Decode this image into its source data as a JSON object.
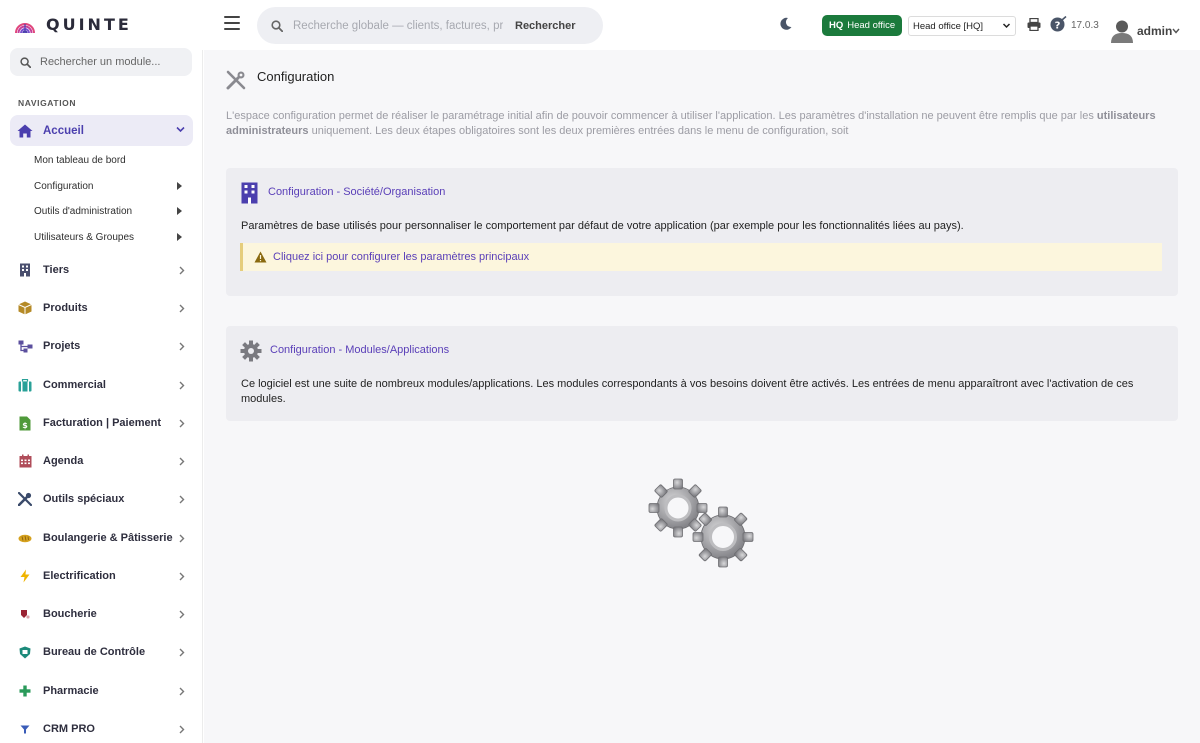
{
  "header": {
    "app_name": "QUINTE",
    "search_placeholder": "Recherche globale — clients, factures, prod",
    "search_button": "Rechercher",
    "entity_badge_code": "HQ",
    "entity_badge_label": "Head office",
    "entity_select_value": "Head office [HQ]",
    "version": "17.0.3",
    "username": "admin"
  },
  "sidebar": {
    "search_placeholder": "Rechercher un module...",
    "nav_title": "NAVIGATION",
    "active": {
      "label": "Accueil",
      "icon": "home-icon"
    },
    "subitems": [
      {
        "label": "Mon tableau de bord",
        "has_arrow": false
      },
      {
        "label": "Configuration",
        "has_arrow": true
      },
      {
        "label": "Outils d'administration",
        "has_arrow": true
      },
      {
        "label": "Utilisateurs & Groupes",
        "has_arrow": true
      }
    ],
    "items": [
      {
        "label": "Tiers",
        "icon": "building-icon",
        "color": "#4a4f6e"
      },
      {
        "label": "Produits",
        "icon": "box-icon",
        "color": "#b58a26"
      },
      {
        "label": "Projets",
        "icon": "sitemap-icon",
        "color": "#5b4f9e"
      },
      {
        "label": "Commercial",
        "icon": "suitcase-icon",
        "color": "#2aa198"
      },
      {
        "label": "Facturation | Paiement",
        "icon": "invoice-icon",
        "color": "#4f9a3a"
      },
      {
        "label": "Agenda",
        "icon": "calendar-icon",
        "color": "#b04d5a"
      },
      {
        "label": "Outils spéciaux",
        "icon": "tools-icon",
        "color": "#3a4a6a"
      },
      {
        "label": "Boulangerie & Pâtisserie",
        "icon": "bread-icon",
        "color": "#d6a21e"
      },
      {
        "label": "Electrification",
        "icon": "bolt-icon",
        "color": "#f0b400"
      },
      {
        "label": "Boucherie",
        "icon": "meat-icon",
        "color": "#9a2233"
      },
      {
        "label": "Bureau de Contrôle",
        "icon": "shield-icon",
        "color": "#1c8a7a"
      },
      {
        "label": "Pharmacie",
        "icon": "cross-icon",
        "color": "#2a9a5a"
      },
      {
        "label": "CRM PRO",
        "icon": "funnel-icon",
        "color": "#3a5cb8"
      }
    ]
  },
  "main": {
    "title": "Configuration",
    "intro_text": "L'espace configuration permet de réaliser le paramétrage initial afin de pouvoir commencer à utiliser l'application. Les paramètres d'installation ne peuvent être remplis que par les ",
    "intro_bold": "utilisateurs administrateurs",
    "intro_text_2": " uniquement. Les deux étapes obligatoires sont les deux premières entrées dans le menu de configuration, soit",
    "card1": {
      "title": "Configuration - Société/Organisation",
      "description": "Paramètres de base utilisés pour personnaliser le comportement par défaut de votre application (par exemple pour les fonctionnalités liées au pays).",
      "warning_link": "Cliquez ici pour configurer les paramètres principaux"
    },
    "card2": {
      "title": "Configuration - Modules/Applications",
      "description": "Ce logiciel est une suite de nombreux modules/applications. Les modules correspondants à vos besoins doivent être activés. Les entrées de menu apparaîtront avec l'activation de ces modules."
    }
  },
  "colors": {
    "accent": "#4b3fae",
    "link": "#5a3fb8",
    "hq_badge": "#1b7a3c",
    "warning_bg": "#fcf6dd"
  }
}
